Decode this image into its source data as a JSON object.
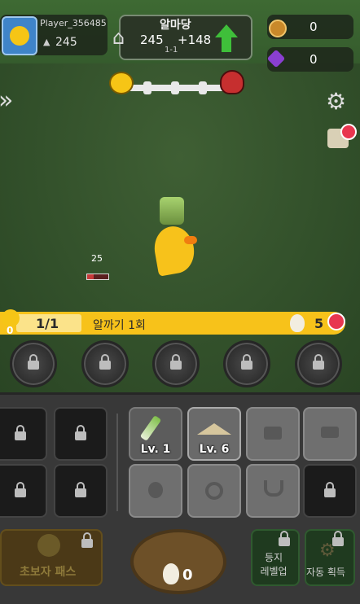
{
  "player": {
    "name": "Player_356485",
    "power": "245"
  },
  "stage": {
    "title": "알마당",
    "power": "245",
    "bonus": "+148",
    "sub": "1-1"
  },
  "currency": {
    "gold": "0",
    "gem": "0"
  },
  "enemy": {
    "level": "25"
  },
  "quest": {
    "progress": "1/1",
    "label": "알까기 1회",
    "eggs": "5",
    "counter": "0"
  },
  "equip_tiles": [
    {
      "level": "Lv. 1"
    },
    {
      "level": "Lv. 6"
    }
  ],
  "bottom": {
    "beginner_pass": "초보자 패스",
    "nest_count": "0",
    "level_up": "등지\n레벨업",
    "auto_get": "자동 획득"
  }
}
